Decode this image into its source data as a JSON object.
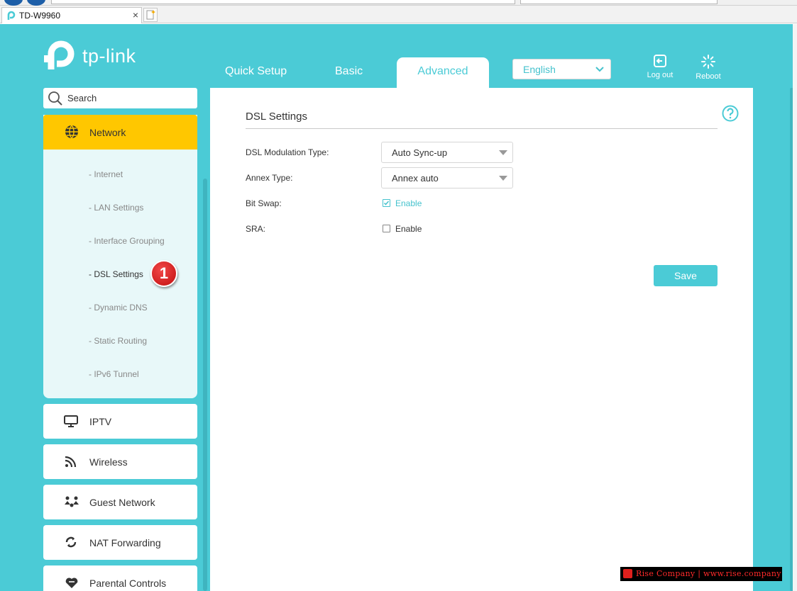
{
  "browser": {
    "tab_title": "TD-W9960",
    "tab_close": "×"
  },
  "brand": {
    "logo_text": "tp-link",
    "accent_color": "#4bcbd6",
    "highlight_color": "#ffc700"
  },
  "topnav": {
    "quick_setup": "Quick Setup",
    "basic": "Basic",
    "advanced": "Advanced",
    "language": "English",
    "logout": "Log out",
    "reboot": "Reboot"
  },
  "sidebar": {
    "search_placeholder": "Search",
    "network": {
      "label": "Network",
      "icon": "globe-icon",
      "items": [
        {
          "label": "- Internet"
        },
        {
          "label": "- LAN Settings"
        },
        {
          "label": "- Interface Grouping"
        },
        {
          "label": "- DSL Settings"
        },
        {
          "label": "- Dynamic DNS"
        },
        {
          "label": "- Static Routing"
        },
        {
          "label": "- IPv6 Tunnel"
        }
      ]
    },
    "badge": "1",
    "items": [
      {
        "label": "IPTV",
        "icon": "monitor-icon"
      },
      {
        "label": "Wireless",
        "icon": "wifi-icon"
      },
      {
        "label": "Guest Network",
        "icon": "guest-network-icon"
      },
      {
        "label": "NAT Forwarding",
        "icon": "nat-forwarding-icon"
      },
      {
        "label": "Parental Controls",
        "icon": "heart-icon"
      }
    ]
  },
  "content": {
    "title": "DSL Settings",
    "fields": {
      "modulation_label": "DSL Modulation Type:",
      "modulation_value": "Auto Sync-up",
      "annex_label": "Annex Type:",
      "annex_value": "Annex auto",
      "bitswap_label": "Bit Swap:",
      "bitswap_enable": "Enable",
      "bitswap_checked": true,
      "sra_label": "SRA:",
      "sra_enable": "Enable",
      "sra_checked": false
    },
    "save_label": "Save"
  },
  "watermark": "Rise Company | www.rise.company"
}
